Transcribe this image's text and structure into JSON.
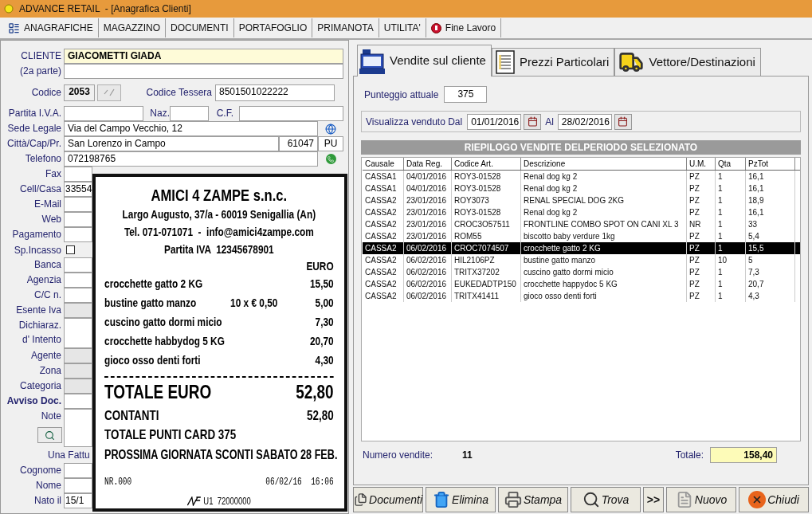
{
  "window": {
    "title": "ADVANCE RETAIL  - [Anagrafica Clienti]"
  },
  "menu": [
    {
      "label": "ANAGRAFICHE",
      "kind": "records"
    },
    {
      "label": "MAGAZZINO",
      "kind": "plain"
    },
    {
      "label": "DOCUMENTI",
      "kind": "plain"
    },
    {
      "label": "PORTAFOGLIO",
      "kind": "plain"
    },
    {
      "label": "PRIMANOTA",
      "kind": "plain"
    },
    {
      "label": "UTILITA'",
      "kind": "plain"
    },
    {
      "label": "Fine Lavoro",
      "kind": "exit"
    }
  ],
  "customer_form": [
    {
      "kind": "highlight",
      "label": "CLIENTE",
      "value": "GIACOMETTI GIADA"
    },
    {
      "kind": "text",
      "label": "(2a parte)"
    },
    {
      "kind": "code",
      "label": "Codice",
      "value": "2053",
      "card_label": "Codice Tessera",
      "card_value": "8501501022222"
    },
    {
      "kind": "vat",
      "label": "Partita I.V.A.",
      "nation_label": "Naz.",
      "tax_code_label": "C.F."
    },
    {
      "kind": "address",
      "label": "Sede Legale",
      "value": "Via del Campo Vecchio, 12"
    },
    {
      "kind": "city",
      "label": "Città/Cap/Pr.",
      "value": "San Lorenzo in Campo",
      "zip": "61047",
      "province": "PU"
    },
    {
      "kind": "phone",
      "label": "Telefono",
      "value": "072198765"
    },
    {
      "kind": "text",
      "label": "Fax"
    },
    {
      "kind": "text",
      "label": "Cell/Casa",
      "value": "33554"
    },
    {
      "kind": "text",
      "label": "E-Mail"
    },
    {
      "kind": "text",
      "label": "Web"
    },
    {
      "kind": "text",
      "label": "Pagamento"
    },
    {
      "kind": "checkbox",
      "label": "Sp.Incasso",
      "checked": false
    },
    {
      "kind": "text",
      "label": "Banca"
    },
    {
      "kind": "text",
      "label": "Agenzia"
    },
    {
      "kind": "text",
      "label": "C/C n."
    },
    {
      "kind": "disabled",
      "label": "Esente Iva"
    },
    {
      "kind": "tall",
      "label": "Dichiaraz.\nd' Intento"
    },
    {
      "kind": "disabled",
      "label": "Agente"
    },
    {
      "kind": "disabled",
      "label": "Zona"
    },
    {
      "kind": "disabled",
      "label": "Categoria"
    },
    {
      "kind": "emphasis",
      "label": "Avviso Doc."
    },
    {
      "kind": "note",
      "label": "Note"
    },
    {
      "kind": "caption",
      "label": "Una Fattu"
    },
    {
      "kind": "text",
      "label": "Cognome"
    },
    {
      "kind": "text",
      "label": "Nome"
    },
    {
      "kind": "text",
      "label": "Nato il",
      "value": "15/1"
    }
  ],
  "receipt": {
    "shop": "AMICI 4 ZAMPE s.n.c.",
    "address": "Largo Augusto, 37/a - 60019 Senigallia (An)",
    "contact": "Tel. 071-071071  -  info@amici4zampe.com",
    "vat": "Partita IVA  12345678901",
    "currency": "EURO",
    "items": [
      {
        "description": "crocchette gatto 2 KG",
        "amount": "15,50"
      },
      {
        "description": "bustine gatto manzo",
        "quantity": "10 x € 0,50",
        "amount": "5,00"
      },
      {
        "description": "cuscino gatto dormi micio",
        "amount": "7,30"
      },
      {
        "description": "crocchette habbydog 5 KG",
        "amount": "20,70"
      },
      {
        "description": "gioco osso denti forti",
        "amount": "4,30"
      }
    ],
    "total_label": "TOTALE EURO",
    "total": "52,80",
    "payment_label": "CONTANTI",
    "payment": "52,80",
    "points": "TOTALE PUNTI CARD 375",
    "promo": "PROSSIMA GIORNATA SCONTI SABATO 28 FEB.",
    "number": "NR.000",
    "datetime": "06/02/16  16:06",
    "fiscal": "U1  72000000"
  },
  "tabs": [
    {
      "label": "Vendite sul cliente",
      "kind": "register",
      "selected": true
    },
    {
      "label": "Prezzi Particolari",
      "kind": "list",
      "selected": false
    },
    {
      "label": "Vettore/Destinazioni",
      "kind": "truck",
      "selected": false
    }
  ],
  "points": {
    "label": "Punteggio attuale",
    "value": "375"
  },
  "period": {
    "label": "Visualizza venduto Dal",
    "from": "01/01/2016",
    "to_label": "Al",
    "to": "28/02/2016"
  },
  "table": {
    "title": "RIEPILOGO VENDITE DELPERIODO SELEZIONATO",
    "columns": [
      "Causale",
      "Data Reg.",
      "Codice Art.",
      "Descrizione",
      "U.M.",
      "Qta",
      "PzTot"
    ],
    "rows": [
      {
        "cells": [
          "CASSA1",
          "04/01/2016",
          "ROY3-01528",
          "Renal dog kg 2",
          "PZ",
          "1",
          "16,1"
        ],
        "selected": false
      },
      {
        "cells": [
          "CASSA1",
          "04/01/2016",
          "ROY3-01528",
          "Renal dog kg 2",
          "PZ",
          "1",
          "16,1"
        ],
        "selected": false
      },
      {
        "cells": [
          "CASSA2",
          "23/01/2016",
          "ROY3073",
          "RENAL SPECIAL DOG 2KG",
          "PZ",
          "1",
          "18,9"
        ],
        "selected": false
      },
      {
        "cells": [
          "CASSA2",
          "23/01/2016",
          "ROY3-01528",
          "Renal dog kg 2",
          "PZ",
          "1",
          "16,1"
        ],
        "selected": false
      },
      {
        "cells": [
          "CASSA2",
          "23/01/2016",
          "CROC3O57511",
          "FRONTLINE COMBO SPOT ON CANI XL 3",
          "NR",
          "1",
          "33"
        ],
        "selected": false
      },
      {
        "cells": [
          "CASSA2",
          "23/01/2016",
          "ROM55",
          "biscotto baby verdure 1kg",
          "PZ",
          "1",
          "5,4"
        ],
        "selected": false
      },
      {
        "cells": [
          "CASSA2",
          "06/02/2016",
          "CROC7074507",
          "crocchette gatto 2 KG",
          "PZ",
          "1",
          "15,5"
        ],
        "selected": true
      },
      {
        "cells": [
          "CASSA2",
          "06/02/2016",
          "HIL2106PZ",
          "bustine gatto manzo",
          "PZ",
          "10",
          "5"
        ],
        "selected": false
      },
      {
        "cells": [
          "CASSA2",
          "06/02/2016",
          "TRITX37202",
          "cuscino gatto dormi micio",
          "PZ",
          "1",
          "7,3"
        ],
        "selected": false
      },
      {
        "cells": [
          "CASSA2",
          "06/02/2016",
          "EUKEDADTP150",
          "crocchette happydoc 5 KG",
          "PZ",
          "1",
          "20,7"
        ],
        "selected": false
      },
      {
        "cells": [
          "CASSA2",
          "06/02/2016",
          "TRITX41411",
          "gioco osso denti forti",
          "PZ",
          "1",
          "4,3"
        ],
        "selected": false
      }
    ]
  },
  "summary": {
    "count_label": "Numero vendite:",
    "count": "11",
    "total_label": "Totale:",
    "total": "158,40"
  },
  "buttons": [
    {
      "label": "Documenti",
      "kind": "documents"
    },
    {
      "label": "Elimina",
      "kind": "delete"
    },
    {
      "label": "Stampa",
      "kind": "print"
    },
    {
      "label": "Trova",
      "kind": "find"
    },
    {
      "label": ">>",
      "kind": "more"
    },
    {
      "label": "Nuovo",
      "kind": "new"
    },
    {
      "label": "Chiudi",
      "kind": "close"
    }
  ]
}
